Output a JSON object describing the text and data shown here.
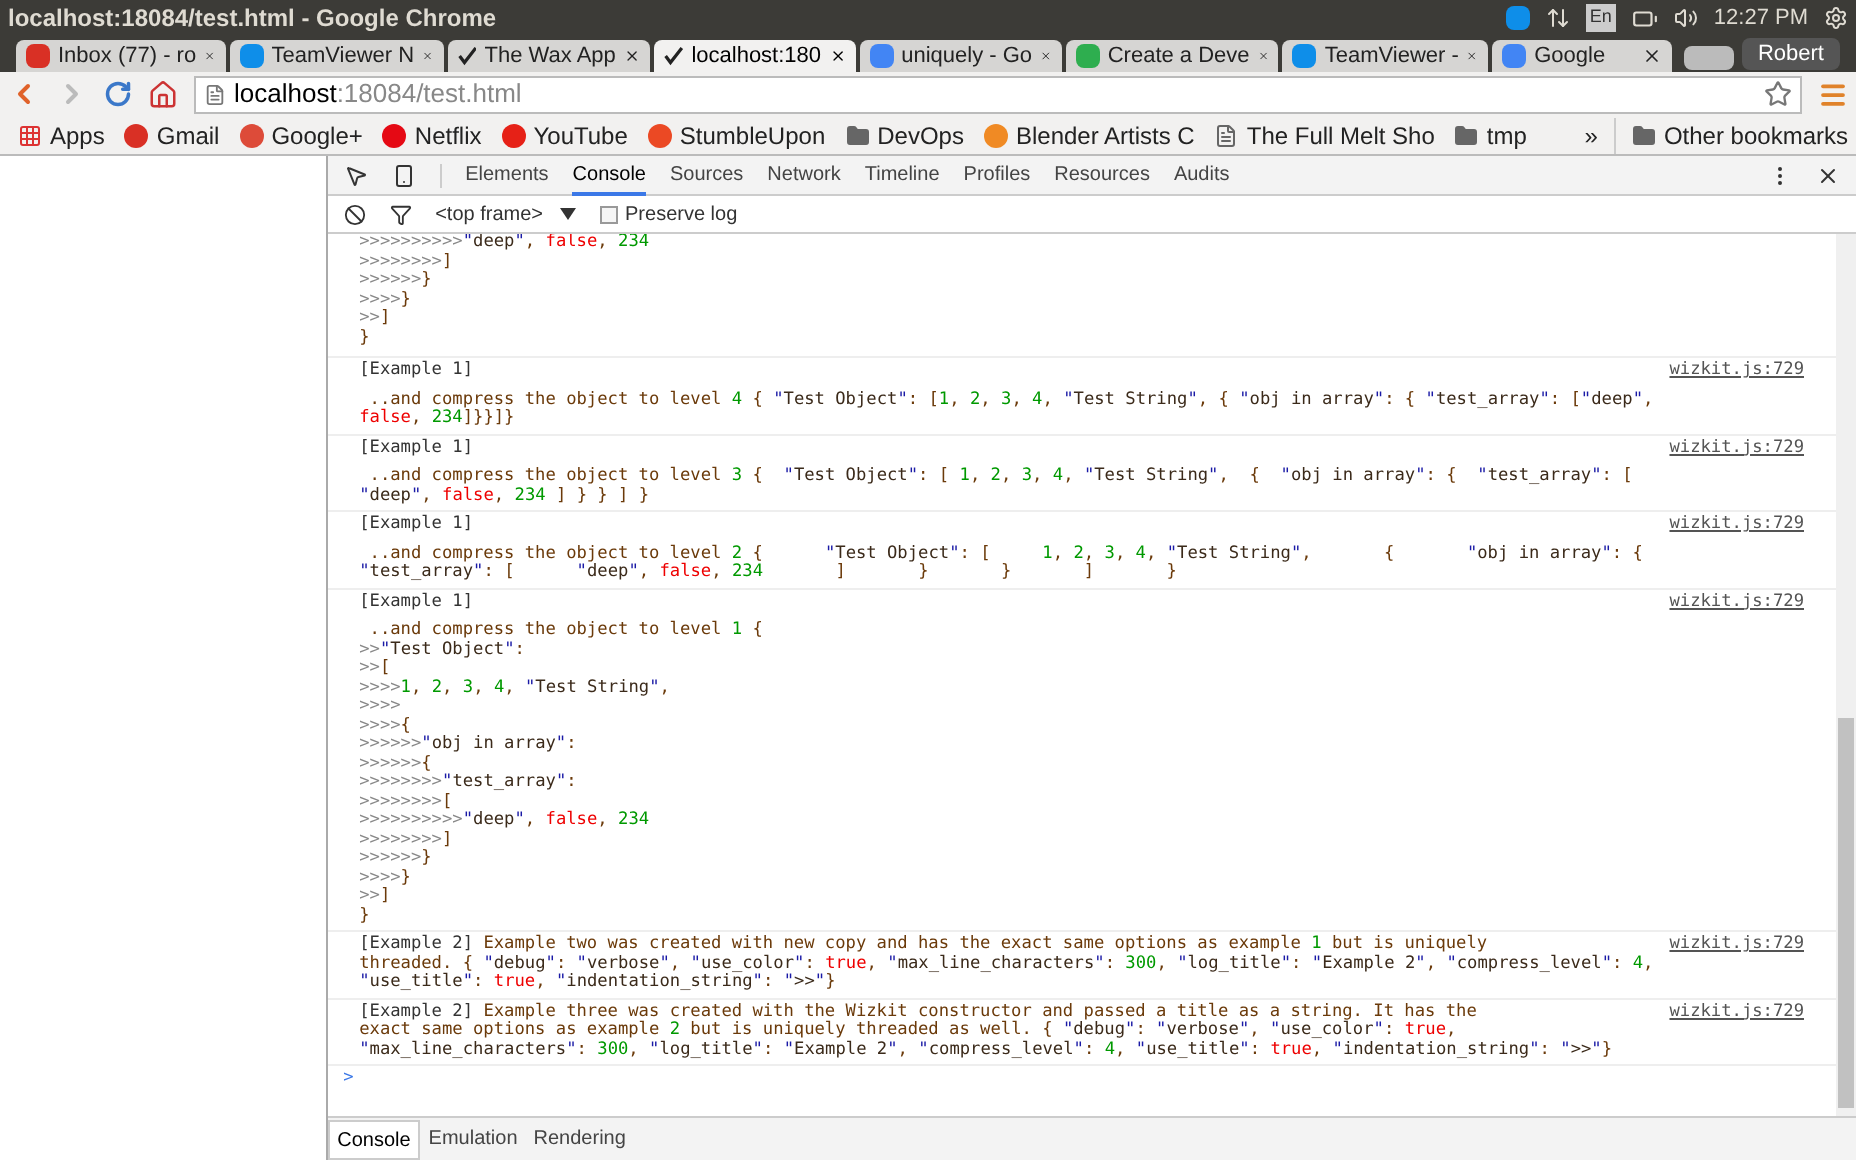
{
  "window": {
    "title": "localhost:18084/test.html - Google Chrome"
  },
  "tray": {
    "language": "En",
    "time": "12:27 PM"
  },
  "tabs": [
    {
      "title": "Inbox (77) - ro",
      "kind": "gmail",
      "selected": false
    },
    {
      "title": "TeamViewer N",
      "kind": "teamviewer",
      "selected": false
    },
    {
      "title": "The Wax App",
      "kind": "check",
      "selected": false
    },
    {
      "title": "localhost:180",
      "kind": "check",
      "selected": true
    },
    {
      "title": "uniquely - Go",
      "kind": "google",
      "selected": false
    },
    {
      "title": "Create a Deve",
      "kind": "green",
      "selected": false
    },
    {
      "title": "TeamViewer -",
      "kind": "teamviewer",
      "selected": false
    },
    {
      "title": "Google",
      "kind": "google",
      "selected": false
    }
  ],
  "profile": "Robert",
  "address": {
    "host": "localhost",
    "rest": ":18084/test.html"
  },
  "bookmarks": [
    {
      "label": "Apps",
      "kind": "apps"
    },
    {
      "label": "Gmail",
      "kind": "gmail"
    },
    {
      "label": "Google+",
      "kind": "gplus"
    },
    {
      "label": "Netflix",
      "kind": "netflix"
    },
    {
      "label": "YouTube",
      "kind": "youtube"
    },
    {
      "label": "StumbleUpon",
      "kind": "stumble"
    },
    {
      "label": "DevOps",
      "kind": "folder"
    },
    {
      "label": "Blender Artists C",
      "kind": "blender"
    },
    {
      "label": "The Full Melt Sho",
      "kind": "page"
    },
    {
      "label": "tmp",
      "kind": "folder"
    }
  ],
  "bookmarks_overflow": "»",
  "other_bookmarks": "Other bookmarks",
  "devtools": {
    "tabs": [
      {
        "label": "Elements",
        "selected": false
      },
      {
        "label": "Console",
        "selected": true
      },
      {
        "label": "Sources",
        "selected": false
      },
      {
        "label": "Network",
        "selected": false
      },
      {
        "label": "Timeline",
        "selected": false
      },
      {
        "label": "Profiles",
        "selected": false
      },
      {
        "label": "Resources",
        "selected": false
      },
      {
        "label": "Audits",
        "selected": false
      }
    ],
    "frame": "<top frame>",
    "preserve_log": {
      "label": "Preserve log",
      "checked": false
    },
    "prompt": ">",
    "drawer_tabs": [
      {
        "label": "Console",
        "selected": true
      },
      {
        "label": "Emulation",
        "selected": false
      },
      {
        "label": "Rendering",
        "selected": false
      }
    ]
  },
  "console": [
    {
      "kind": "tail",
      "lines": [
        ">>>>>>>>>>\"deep\", false, 234",
        ">>>>>>>>]",
        ">>>>>>}",
        ">>>>}",
        ">>]",
        "}"
      ]
    },
    {
      "kind": "block",
      "header": "[Example 1]",
      "source": "wizkit.js:729",
      "lines": [
        " ..and compress the object to level 4 { \"Test Object\": [1, 2, 3, 4, \"Test String\", { \"obj in array\": { \"test_array\": [\"deep\",",
        "false, 234]}}]}"
      ]
    },
    {
      "kind": "block",
      "header": "[Example 1]",
      "source": "wizkit.js:729",
      "lines": [
        " ..and compress the object to level 3 {  \"Test Object\": [ 1, 2, 3, 4, \"Test String\",  {  \"obj in array\": {  \"test_array\": [",
        "\"deep\", false, 234 ] } } ] }"
      ]
    },
    {
      "kind": "block",
      "header": "[Example 1]",
      "source": "wizkit.js:729",
      "lines": [
        " ..and compress the object to level 2 {      \"Test Object\": [     1, 2, 3, 4, \"Test String\",       {       \"obj in array\": {",
        "\"test_array\": [      \"deep\", false, 234       ]       }       }       ]       }"
      ]
    },
    {
      "kind": "block",
      "header": "[Example 1]",
      "source": "wizkit.js:729",
      "lines": [
        " ..and compress the object to level 1 {",
        ">>\"Test Object\":",
        ">>[",
        ">>>>1, 2, 3, 4, \"Test String\",",
        ">>>>",
        ">>>>{",
        ">>>>>>\"obj in array\":",
        ">>>>>>{",
        ">>>>>>>>\"test_array\":",
        ">>>>>>>>[",
        ">>>>>>>>>>\"deep\", false, 234",
        ">>>>>>>>]",
        ">>>>>>}",
        ">>>>}",
        ">>]",
        "}"
      ]
    },
    {
      "kind": "inline",
      "header": "[Example 2]",
      "source": "wizkit.js:729",
      "lines": [
        " Example two was created with new copy and has the exact same options as example 1 but is uniquely",
        "threaded. { \"debug\": \"verbose\", \"use_color\": true, \"max_line_characters\": 300, \"log_title\": \"Example 2\", \"compress_level\": 4,",
        "\"use_title\": true, \"indentation_string\": \">>\"}"
      ]
    },
    {
      "kind": "inline",
      "header": "[Example 2]",
      "source": "wizkit.js:729",
      "lines": [
        " Example three was created with the Wizkit constructor and passed a title as a string. It has the",
        "exact same options as example 2 but is uniquely threaded as well. { \"debug\": \"verbose\", \"use_color\": true,",
        "\"max_line_characters\": 300, \"log_title\": \"Example 2\", \"compress_level\": 4, \"use_title\": true, \"indentation_string\": \">>\"}"
      ]
    }
  ]
}
